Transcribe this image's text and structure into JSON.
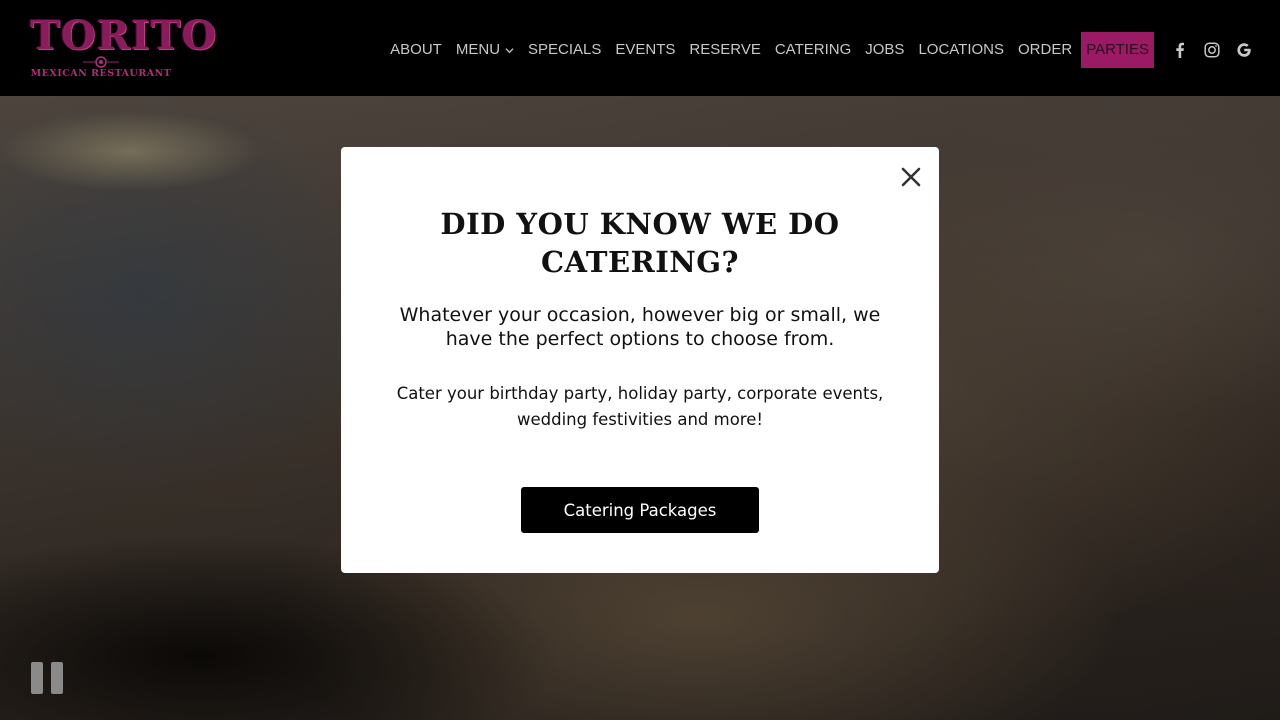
{
  "brand": {
    "name": "TORITO",
    "tagline": "MEXICAN RESTAURANT"
  },
  "nav": {
    "items": [
      {
        "label": "ABOUT"
      },
      {
        "label": "MENU",
        "has_dropdown": true
      },
      {
        "label": "SPECIALS"
      },
      {
        "label": "EVENTS"
      },
      {
        "label": "RESERVE"
      },
      {
        "label": "CATERING"
      },
      {
        "label": "JOBS"
      },
      {
        "label": "LOCATIONS"
      },
      {
        "label": "ORDER"
      },
      {
        "label": "PARTIES",
        "active": true
      }
    ],
    "social": [
      {
        "icon": "facebook-icon"
      },
      {
        "icon": "instagram-icon"
      },
      {
        "icon": "google-icon"
      }
    ]
  },
  "modal": {
    "title": "DID YOU KNOW WE DO CATERING?",
    "lead": "Whatever your occasion, however big or small, we have the perfect options to choose from.",
    "body": "Cater your birthday party, holiday party, corporate events, wedding festivities and more!",
    "cta_label": "Catering Packages",
    "close_icon": "close-icon"
  },
  "hero": {
    "control_icon": "pause-icon"
  },
  "colors": {
    "brand_accent": "#9b1a64",
    "header_bg": "#000000",
    "button_bg": "#000000",
    "modal_bg": "#ffffff"
  }
}
